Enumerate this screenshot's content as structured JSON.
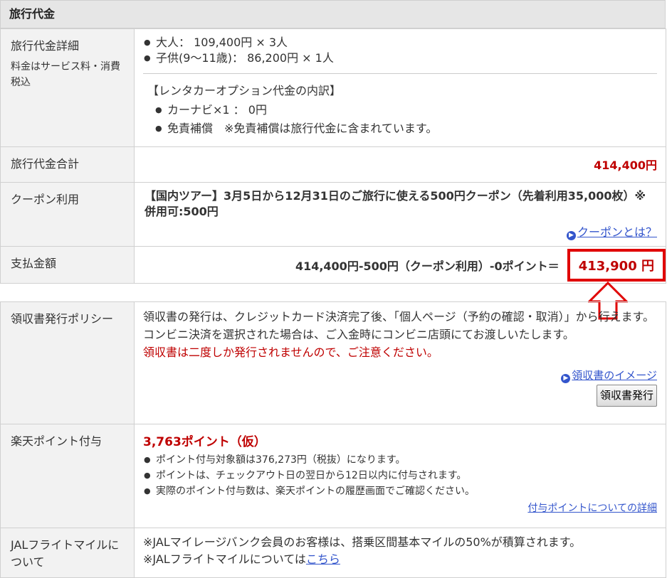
{
  "header": {
    "title": "旅行代金"
  },
  "detail": {
    "label": "旅行代金詳細",
    "sublabel": "料金はサービス料・消費税込",
    "items": [
      "大人： 109,400円 × 3人",
      "子供(9～11歳)： 86,200円 × 1人"
    ],
    "option_title": "【レンタカーオプション代金の内訳】",
    "option_items": [
      "カーナビ×1 ： 0円",
      "免責補償　※免責補償は旅行代金に含まれています。"
    ]
  },
  "total": {
    "label": "旅行代金合計",
    "value": "414,400円"
  },
  "coupon": {
    "label": "クーポン利用",
    "text": "【国内ツアー】3月5日から12月31日のご旅行に使える500円クーポン（先着利用35,000枚）※併用可:500円",
    "link": "クーポンとは？"
  },
  "payment": {
    "label": "支払金額",
    "formula": "414,400円-500円（クーポン利用）-0ポイント＝",
    "amount": "413,900 円"
  },
  "receipt": {
    "label": "領収書発行ポリシー",
    "text1": "領収書の発行は、クレジットカード決済完了後、「個人ページ（予約の確認・取消）」から行えます。",
    "text2": "コンビニ決済を選択された場合は、ご入金時にコンビニ店頭にてお渡しいたします。",
    "warning": "領収書は二度しか発行されませんので、ご注意ください。",
    "link": "領収書のイメージ",
    "button": "領収書発行"
  },
  "points": {
    "label": "楽天ポイント付与",
    "value": "3,763ポイント（仮）",
    "items": [
      "ポイント付与対象額は376,273円（税抜）になります。",
      "ポイントは、チェックアウト日の翌日から12日以内に付与されます。",
      "実際のポイント付与数は、楽天ポイントの履歴画面でご確認ください。"
    ],
    "link": "付与ポイントについての詳細"
  },
  "jal": {
    "label": "JALフライトマイルについて",
    "line1": "※JALマイレージバンク会員のお客様は、搭乗区間基本マイルの50%が積算されます。",
    "line2_prefix": "※JALフライトマイルについては",
    "line2_link": "こちら"
  },
  "colors": {
    "accent_red": "#bf0000",
    "link_blue": "#3355cc",
    "highlight_red": "#e00000"
  }
}
